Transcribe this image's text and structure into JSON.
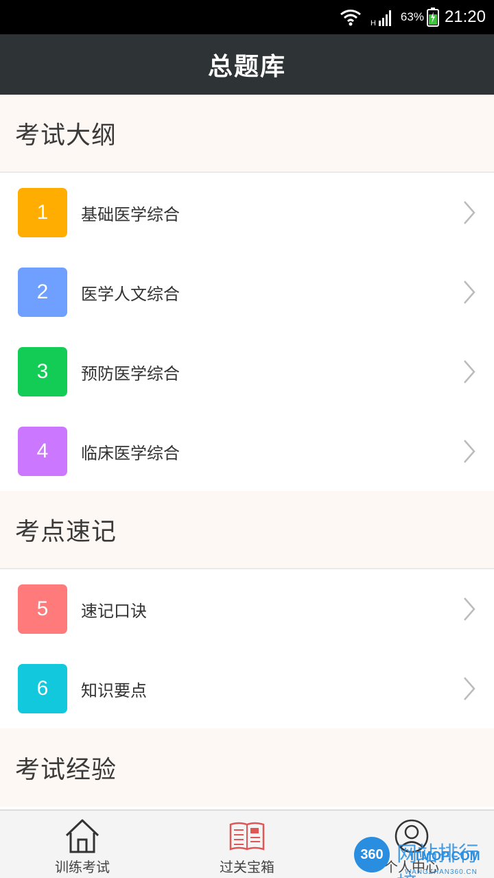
{
  "status_bar": {
    "battery_percent": "63%",
    "time": "21:20"
  },
  "app_bar": {
    "title": "总题库"
  },
  "sections": [
    {
      "title": "考试大纲",
      "items": [
        {
          "number": "1",
          "label": "基础医学综合",
          "color": "#ffad00"
        },
        {
          "number": "2",
          "label": "医学人文综合",
          "color": "#6fa0ff"
        },
        {
          "number": "3",
          "label": "预防医学综合",
          "color": "#12cc55"
        },
        {
          "number": "4",
          "label": "临床医学综合",
          "color": "#cc77ff"
        }
      ]
    },
    {
      "title": "考点速记",
      "items": [
        {
          "number": "5",
          "label": "速记口诀",
          "color": "#ff7a7a"
        },
        {
          "number": "6",
          "label": "知识要点",
          "color": "#12c8dc"
        }
      ]
    },
    {
      "title": "考试经验",
      "items": []
    }
  ],
  "bottom_nav": {
    "tabs": [
      {
        "label": "训练考试",
        "icon": "home-icon"
      },
      {
        "label": "过关宝箱",
        "icon": "book-icon"
      },
      {
        "label": "个人中心",
        "icon": "user-icon"
      }
    ]
  },
  "watermark": {
    "badge": "360",
    "text": "网站排行榜",
    "brand": "ITMOP.COM",
    "url": "WANGZHAN360.CN"
  }
}
